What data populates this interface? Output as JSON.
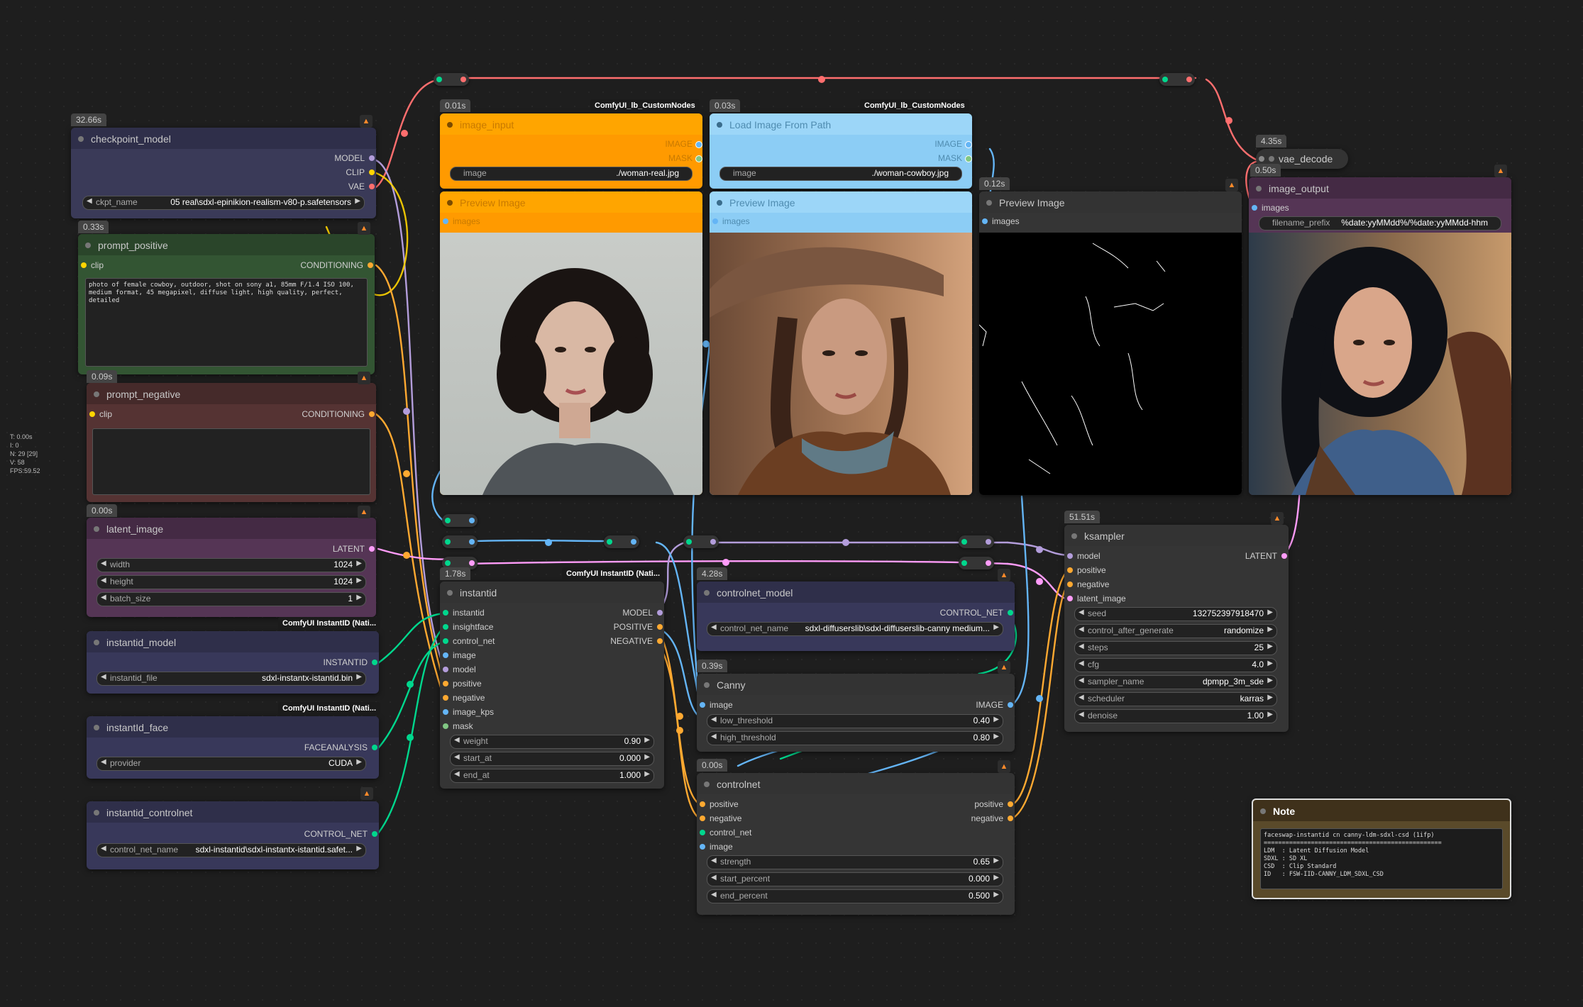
{
  "stats": [
    "T: 0.00s",
    "I: 0",
    "N: 29 [29]",
    "V: 58",
    "FPS:59.52"
  ],
  "colors": {
    "clip": "#ffd500",
    "conditioning": "#ffa931",
    "latent": "#ff9cf9",
    "model": "#b39ddb",
    "vae": "#ff6e6e",
    "image": "#64b5f6",
    "control": "#00d78d",
    "mask": "#81c784",
    "misc": "#a1a1a1"
  },
  "nodes": {
    "checkpoint": {
      "time": "32.66s",
      "title": "checkpoint_model",
      "outputs": [
        "MODEL",
        "CLIP",
        "VAE"
      ],
      "widget": {
        "label": "ckpt_name",
        "value": "05 real\\sdxl-epinikion-realism-v80-p.safetensors"
      }
    },
    "prompt_positive": {
      "time": "0.33s",
      "title": "prompt_positive",
      "input": "clip",
      "output": "CONDITIONING",
      "text": "photo of female cowboy, outdoor, shot on sony a1, 85mm F/1.4 ISO 100, medium format, 45 megapixel, diffuse light, high quality, perfect, detailed"
    },
    "prompt_negative": {
      "time": "0.09s",
      "title": "prompt_negative",
      "input": "clip",
      "output": "CONDITIONING",
      "text": ""
    },
    "latent_image": {
      "time": "0.00s",
      "title": "latent_image",
      "output": "LATENT",
      "widgets": [
        {
          "label": "width",
          "value": "1024"
        },
        {
          "label": "height",
          "value": "1024"
        },
        {
          "label": "batch_size",
          "value": "1"
        }
      ]
    },
    "instantid_model": {
      "badge": "ComfyUI InstantID (Nati...",
      "title": "instantid_model",
      "output": "INSTANTID",
      "widget": {
        "label": "instantid_file",
        "value": "sdxl-instantx-istantid.bin"
      }
    },
    "instantid_face": {
      "badge": "ComfyUI InstantID (Nati...",
      "title": "instantId_face",
      "output": "FACEANALYSIS",
      "widget": {
        "label": "provider",
        "value": "CUDA"
      }
    },
    "instantid_controlnet": {
      "title": "instantid_controlnet",
      "output": "CONTROL_NET",
      "widget": {
        "label": "control_net_name",
        "value": "sdxl-instantid\\sdxl-instantx-istantid.safet..."
      }
    },
    "image_input": {
      "time": "0.01s",
      "badge": "ComfyUI_lb_CustomNodes",
      "title": "image_input",
      "outputs": [
        "IMAGE",
        "MASK"
      ],
      "widget": {
        "label": "image",
        "value": "./woman-real.jpg"
      }
    },
    "load_image_path": {
      "time": "0.03s",
      "badge": "ComfyUI_lb_CustomNodes",
      "title": "Load Image From Path",
      "outputs": [
        "IMAGE",
        "MASK"
      ],
      "widget": {
        "label": "image",
        "value": "./woman-cowboy.jpg"
      }
    },
    "preview1": {
      "title": "Preview Image",
      "input": "images"
    },
    "preview2": {
      "title": "Preview Image",
      "input": "images"
    },
    "preview3": {
      "time": "0.12s",
      "title": "Preview Image",
      "input": "images"
    },
    "vae_decode": {
      "time": "4.35s",
      "title": "vae_decode"
    },
    "image_output": {
      "time": "0.50s",
      "title": "image_output",
      "input": "images",
      "widget": {
        "label": "filename_prefix",
        "value": "%date:yyMMdd%/%date:yyMMdd-hhm"
      }
    },
    "instantid": {
      "time": "1.78s",
      "badge": "ComfyUI InstantID (Nati...",
      "title": "instantid",
      "inputs": [
        "instantid",
        "insightface",
        "control_net",
        "image",
        "model",
        "positive",
        "negative",
        "image_kps",
        "mask"
      ],
      "outputs": [
        "MODEL",
        "POSITIVE",
        "NEGATIVE"
      ],
      "widgets": [
        {
          "label": "weight",
          "value": "0.90"
        },
        {
          "label": "start_at",
          "value": "0.000"
        },
        {
          "label": "end_at",
          "value": "1.000"
        }
      ]
    },
    "controlnet_model": {
      "time": "4.28s",
      "title": "controlnet_model",
      "output": "CONTROL_NET",
      "widget": {
        "label": "control_net_name",
        "value": "sdxl-diffuserslib\\sdxl-diffuserslib-canny medium..."
      }
    },
    "canny": {
      "time": "0.39s",
      "title": "Canny",
      "input": "image",
      "output": "IMAGE",
      "widgets": [
        {
          "label": "low_threshold",
          "value": "0.40"
        },
        {
          "label": "high_threshold",
          "value": "0.80"
        }
      ]
    },
    "controlnet": {
      "time": "0.00s",
      "title": "controlnet",
      "inputs": [
        "positive",
        "negative",
        "control_net",
        "image"
      ],
      "outputs": [
        "positive",
        "negative"
      ],
      "widgets": [
        {
          "label": "strength",
          "value": "0.65"
        },
        {
          "label": "start_percent",
          "value": "0.000"
        },
        {
          "label": "end_percent",
          "value": "0.500"
        }
      ]
    },
    "ksampler": {
      "time": "51.51s",
      "title": "ksampler",
      "inputs": [
        "model",
        "positive",
        "negative",
        "latent_image"
      ],
      "output": "LATENT",
      "widgets": [
        {
          "label": "seed",
          "value": "132752397918470"
        },
        {
          "label": "control_after_generate",
          "value": "randomize"
        },
        {
          "label": "steps",
          "value": "25"
        },
        {
          "label": "cfg",
          "value": "4.0"
        },
        {
          "label": "sampler_name",
          "value": "dpmpp_3m_sde"
        },
        {
          "label": "scheduler",
          "value": "karras"
        },
        {
          "label": "denoise",
          "value": "1.00"
        }
      ]
    },
    "note": {
      "title": "Note",
      "text": "faceswap-instantid cn canny-ldm-sdxl-csd (1ifp)\n=================================================\nLDM  : Latent Diffusion Model\nSDXL : SD XL\nCSD  : Clip Standard\nID   : FSW-IID-CANNY_LDM_SDXL_CSD"
    }
  }
}
